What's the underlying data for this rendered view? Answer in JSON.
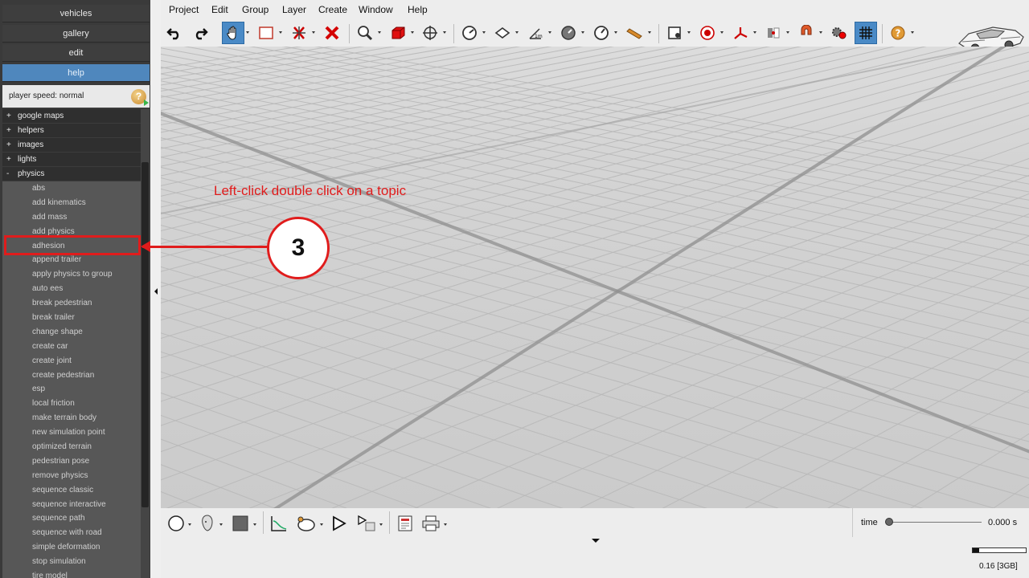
{
  "nav": [
    {
      "label": "vehicles",
      "active": false
    },
    {
      "label": "gallery",
      "active": false
    },
    {
      "label": "edit",
      "active": false
    },
    {
      "label": "help",
      "active": true
    }
  ],
  "player_speed": {
    "label": "player speed: normal",
    "help_glyph": "?"
  },
  "tree": {
    "categories": [
      {
        "sign": "+",
        "label": "google maps"
      },
      {
        "sign": "+",
        "label": "helpers"
      },
      {
        "sign": "+",
        "label": "images"
      },
      {
        "sign": "+",
        "label": "lights"
      },
      {
        "sign": "-",
        "label": "physics"
      }
    ],
    "topics": [
      "abs",
      "add kinematics",
      "add mass",
      "add physics",
      "adhesion",
      "append trailer",
      "apply physics to group",
      "auto ees",
      "break pedestrian",
      "break trailer",
      "change shape",
      "create car",
      "create joint",
      "create pedestrian",
      "esp",
      "local friction",
      "make terrain body",
      "new simulation point",
      "optimized terrain",
      "pedestrian pose",
      "remove physics",
      "sequence classic",
      "sequence interactive",
      "sequence path",
      "sequence with road",
      "simple deformation",
      "stop simulation",
      "tire model"
    ],
    "selected_topic": "adhesion"
  },
  "menu": [
    "Project",
    "Edit",
    "Group",
    "Layer",
    "Create",
    "Window",
    "Help"
  ],
  "toolbar_icons": [
    "undo-icon",
    "redo-icon",
    "hand-icon",
    "select-rectangle-icon",
    "move-icon",
    "delete-icon",
    "zoom-icon",
    "box-icon",
    "pan-icon",
    "measure-icon",
    "plane-icon",
    "distance-icon",
    "gauge-icon",
    "dial-icon",
    "ruler-icon",
    "frame-icon",
    "target-icon",
    "axis-icon",
    "mirror-icon",
    "magnet-icon",
    "settings-icon",
    "grid-icon",
    "help-icon"
  ],
  "annotation": {
    "instruction": "Left-click double click on a topic",
    "step": "3",
    "color": "#e01c1c"
  },
  "timeline": {
    "label": "time",
    "value": "0.000 s",
    "progress": 0
  },
  "memory": {
    "label": "0.16 [3GB]",
    "usage_fraction": 0.12
  },
  "colors": {
    "accent": "#4f87bd",
    "panel": "#3a3a3a",
    "topic_bg": "#575757"
  }
}
